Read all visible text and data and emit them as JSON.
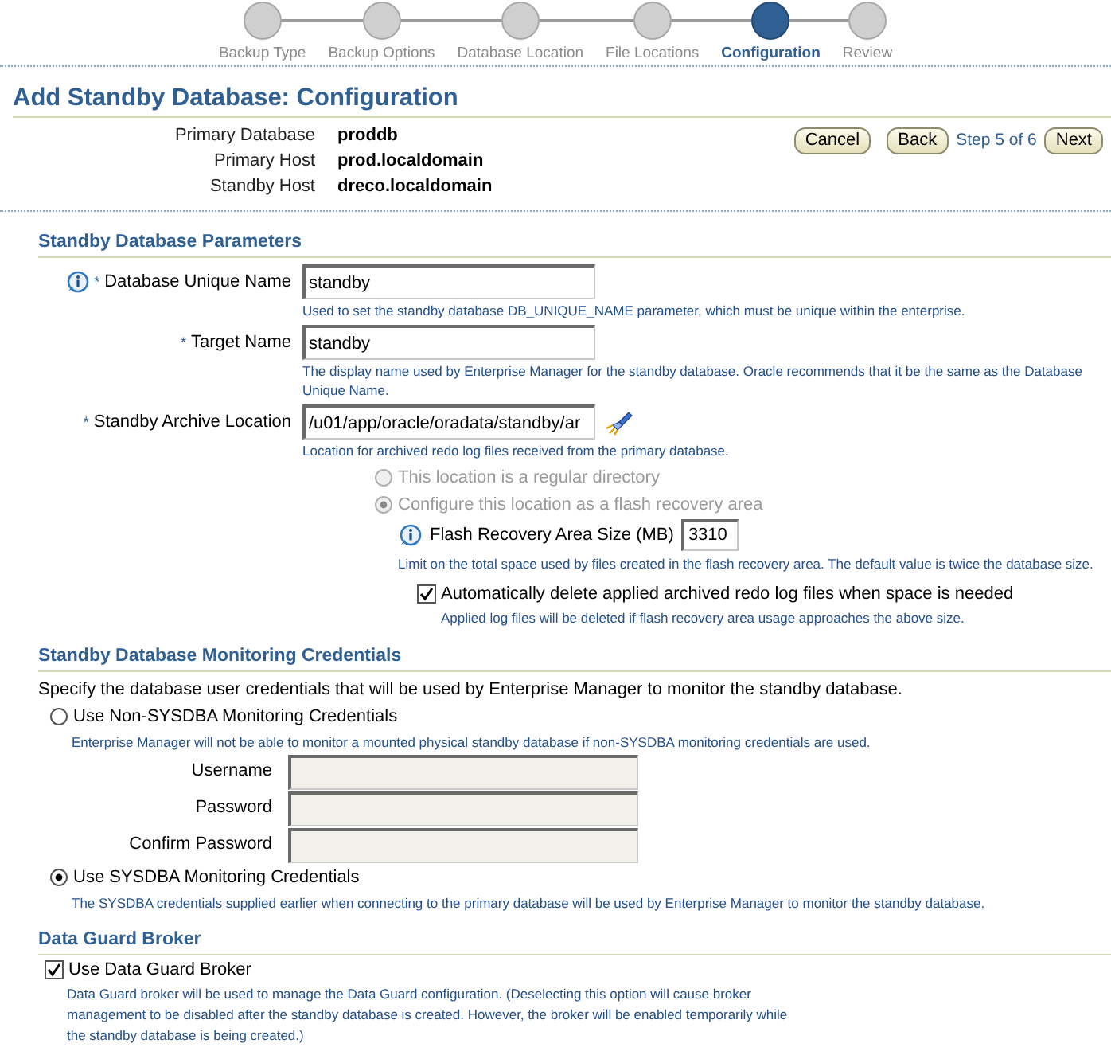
{
  "train": {
    "steps": [
      {
        "label": "Backup Type",
        "selected": false
      },
      {
        "label": "Backup Options",
        "selected": false
      },
      {
        "label": "Database Location",
        "selected": false
      },
      {
        "label": "File Locations",
        "selected": false
      },
      {
        "label": "Configuration",
        "selected": true
      },
      {
        "label": "Review",
        "selected": false
      }
    ]
  },
  "page_title": "Add Standby Database: Configuration",
  "summary": [
    {
      "label": "Primary Database",
      "value": "proddb"
    },
    {
      "label": "Primary Host",
      "value": "prod.localdomain"
    },
    {
      "label": "Standby Host",
      "value": "dreco.localdomain"
    }
  ],
  "actions": {
    "cancel": "Cancel",
    "back": "Back",
    "step": "Step 5 of 6",
    "next": "Next"
  },
  "parameters": {
    "title": "Standby Database Parameters",
    "fields": [
      {
        "label": "Database Unique Name",
        "required_mark": "*",
        "info": true,
        "value": "standby",
        "browse": false,
        "hint": "Used to set the standby database DB_UNIQUE_NAME parameter, which must be unique within the enterprise."
      },
      {
        "label": "Target Name",
        "required_mark": "*",
        "info": false,
        "value": "standby",
        "browse": false,
        "hint": "The display name used by Enterprise Manager for the standby database. Oracle recommends that it be the same as the Database Unique Name."
      },
      {
        "label": "Standby Archive Location",
        "required_mark": "*",
        "info": false,
        "value": "/u01/app/oracle/oradata/standby/ar",
        "browse": true,
        "hint": "Location for archived redo log files received from the primary database."
      }
    ],
    "archive_options": [
      {
        "label": "This location is a regular directory",
        "selected": false,
        "disabled": true
      },
      {
        "label": "Configure this location as a flash recovery area",
        "selected": true,
        "disabled": true
      }
    ],
    "flash_size": {
      "label": "Flash Recovery Area Size (MB)",
      "value": "3310",
      "hint": "Limit on the total space used by files created in the flash recovery area. The default value is twice the database size."
    },
    "auto_delete": {
      "label": "Automatically delete applied archived redo log files when space is needed",
      "checked": true,
      "hint": "Applied log files will be deleted if flash recovery area usage approaches the above size."
    }
  },
  "monitoring": {
    "title": "Standby Database Monitoring Credentials",
    "intro": "Specify the database user credentials that will be used by Enterprise Manager to monitor the standby database.",
    "options": [
      {
        "label": "Use Non-SYSDBA Monitoring Credentials",
        "selected": false,
        "hint": "Enterprise Manager will not be able to monitor a mounted physical standby database if non-SYSDBA monitoring credentials are used.",
        "fields": [
          {
            "label": "Username",
            "disabled": true
          },
          {
            "label": "Password",
            "disabled": true
          },
          {
            "label": "Confirm Password",
            "disabled": true
          }
        ]
      },
      {
        "label": "Use SYSDBA Monitoring Credentials",
        "selected": true,
        "hint": "The SYSDBA credentials supplied earlier when connecting to the primary database will be used by Enterprise Manager to monitor the standby database."
      }
    ]
  },
  "broker": {
    "title": "Data Guard Broker",
    "label": "Use Data Guard Broker",
    "checked": true,
    "hint": "Data Guard broker will be used to manage the Data Guard configuration. (Deselecting this option will cause broker management to be disabled after the standby database is created. However, the broker will be enabled temporarily while the standby database is being created.)"
  }
}
